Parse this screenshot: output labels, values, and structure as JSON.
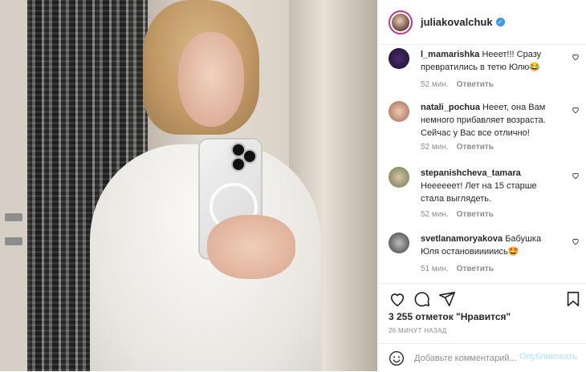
{
  "post": {
    "username": "juliakovalchuk",
    "verified_icon": "verified-badge-icon",
    "likes_text": "3 255 отметок \"Нравится\"",
    "timestamp": "26 МИНУТ НАЗАД"
  },
  "comments": [
    {
      "author": "l_mamarishka",
      "text": "Нееет!!! Сразу превратились в тетю Юлю😂",
      "time": "52 мин.",
      "reply": "Ответить"
    },
    {
      "author": "natali_pochua",
      "text": "Нееет, она Вам немного прибавляет возраста. Сейчас у Вас все отлично!",
      "time": "52 мин.",
      "reply": "Ответить"
    },
    {
      "author": "stepanishcheva_tamara",
      "text": "Неееееет! Лет на 15 старше стала выглядеть.",
      "time": "52 мин.",
      "reply": "Ответить"
    },
    {
      "author": "svetlanamoryakova",
      "text": "Бабушка Юля остановииииись🤩",
      "time": "51 мин.",
      "reply": "Ответить"
    }
  ],
  "add_comment": {
    "placeholder": "Добавьте комментарий...",
    "publish_label": "Опубликовать"
  },
  "colors": {
    "accent": "#3897f0",
    "publish_disabled": "#b2dffc",
    "muted": "#8e8e8e"
  }
}
